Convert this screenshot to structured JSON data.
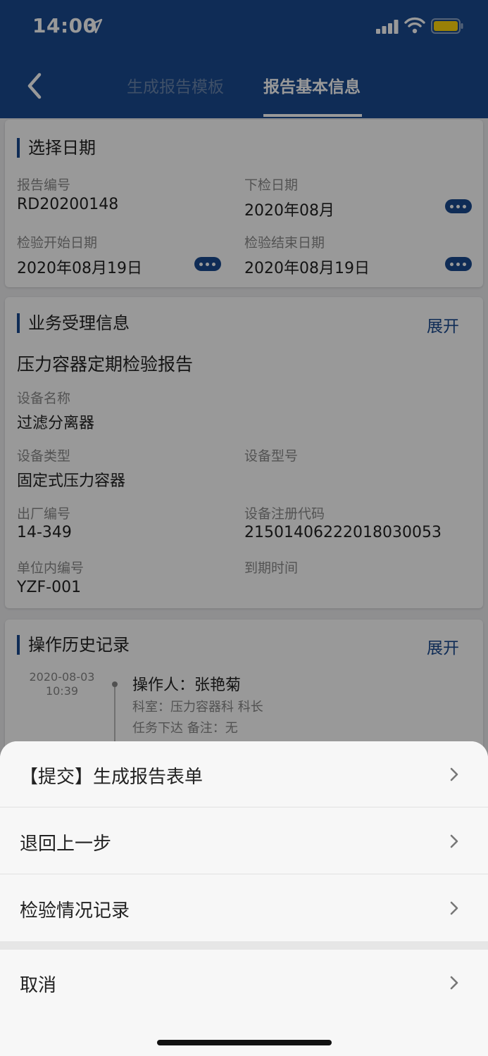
{
  "status_bar": {
    "time": "14:00"
  },
  "header": {
    "tabs": [
      {
        "label": "生成报告模板",
        "active": false
      },
      {
        "label": "报告基本信息",
        "active": true
      }
    ]
  },
  "date_section": {
    "title": "选择日期",
    "fields": [
      {
        "label": "报告编号",
        "value": "RD20200148"
      },
      {
        "label": "下检日期",
        "value": "2020年08月"
      },
      {
        "label": "检验开始日期",
        "value": "2020年08月19日"
      },
      {
        "label": "检验结束日期",
        "value": "2020年08月19日"
      }
    ]
  },
  "business_section": {
    "title": "业务受理信息",
    "expand_label": "展开",
    "report_type": "压力容器定期检验报告",
    "fields": [
      {
        "label": "设备名称",
        "value": "过滤分离器"
      },
      {
        "label": "设备类型",
        "value": "固定式压力容器"
      },
      {
        "label": "设备型号",
        "value": ""
      },
      {
        "label": "出厂编号",
        "value": "14-349"
      },
      {
        "label": "设备注册代码",
        "value": "21501406222018030053"
      },
      {
        "label": "单位内编号",
        "value": "YZF-001"
      },
      {
        "label": "到期时间",
        "value": ""
      }
    ]
  },
  "history_section": {
    "title": "操作历史记录",
    "expand_label": "展开",
    "entries": [
      {
        "date": "2020-08-03",
        "time": "10:39",
        "operator": "操作人：张艳菊",
        "department": "科室：压力容器科  科长",
        "note": "任务下达 备注：无"
      }
    ]
  },
  "action_sheet": {
    "items": [
      {
        "label": "【提交】生成报告表单"
      },
      {
        "label": "退回上一步"
      },
      {
        "label": "检验情况记录"
      }
    ],
    "cancel_label": "取消"
  },
  "colors": {
    "header_bg": "#1a4a8f",
    "accent": "#1a4a8f",
    "battery": "#ffd60a"
  }
}
